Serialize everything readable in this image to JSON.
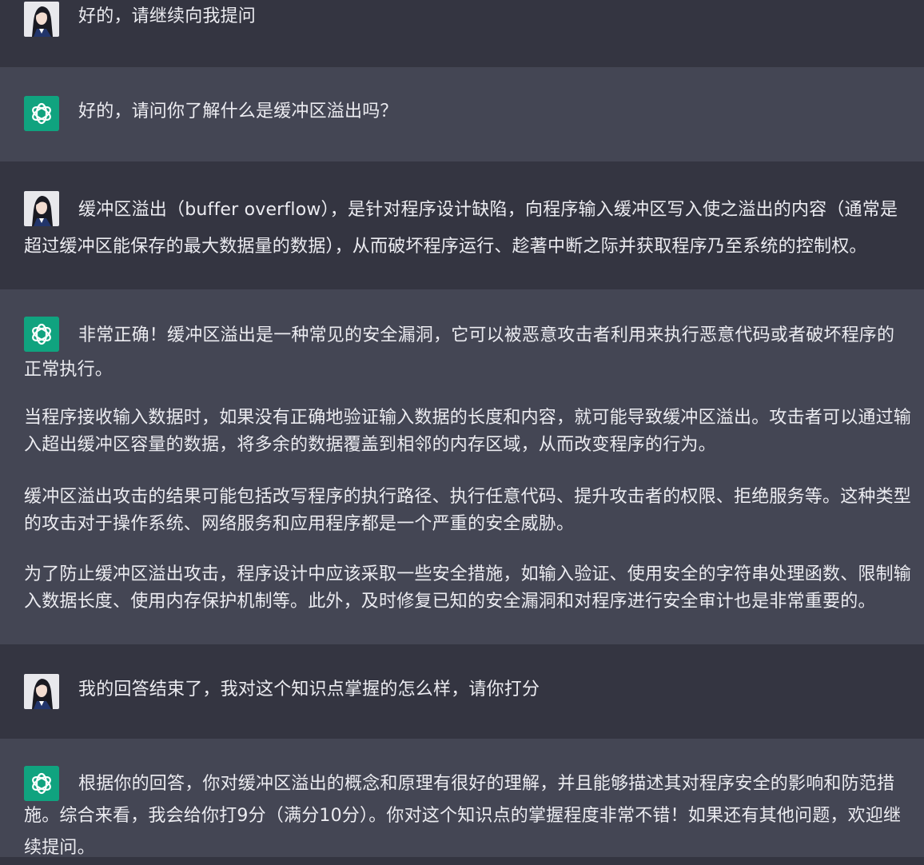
{
  "colors": {
    "user_bg": "#343541",
    "bot_bg": "#444654",
    "text": "#ececf1",
    "gpt_icon_bg": "#10a37f"
  },
  "messages": [
    {
      "role": "user",
      "avatar": "user-avatar",
      "paragraphs": [
        "好的，请继续向我提问"
      ]
    },
    {
      "role": "assistant",
      "avatar": "openai-logo-icon",
      "paragraphs": [
        "好的，请问你了解什么是缓冲区溢出吗？"
      ]
    },
    {
      "role": "user",
      "avatar": "user-avatar",
      "paragraphs": [
        "缓冲区溢出（buffer overflow），是针对程序设计缺陷，向程序输入缓冲区写入使之溢出的内容（通常是超过缓冲区能保存的最大数据量的数据），从而破坏程序运行、趁著中断之际并获取程序乃至系统的控制权。"
      ]
    },
    {
      "role": "assistant",
      "avatar": "openai-logo-icon",
      "paragraphs": [
        "非常正确！缓冲区溢出是一种常见的安全漏洞，它可以被恶意攻击者利用来执行恶意代码或者破坏程序的正常执行。",
        "当程序接收输入数据时，如果没有正确地验证输入数据的长度和内容，就可能导致缓冲区溢出。攻击者可以通过输入超出缓冲区容量的数据，将多余的数据覆盖到相邻的内存区域，从而改变程序的行为。",
        "缓冲区溢出攻击的结果可能包括改写程序的执行路径、执行任意代码、提升攻击者的权限、拒绝服务等。这种类型的攻击对于操作系统、网络服务和应用程序都是一个严重的安全威胁。",
        "为了防止缓冲区溢出攻击，程序设计中应该采取一些安全措施，如输入验证、使用安全的字符串处理函数、限制输入数据长度、使用内存保护机制等。此外，及时修复已知的安全漏洞和对程序进行安全审计也是非常重要的。"
      ]
    },
    {
      "role": "user",
      "avatar": "user-avatar",
      "paragraphs": [
        "我的回答结束了，我对这个知识点掌握的怎么样，请你打分"
      ]
    },
    {
      "role": "assistant",
      "avatar": "openai-logo-icon",
      "paragraphs": [
        "根据你的回答，你对缓冲区溢出的概念和原理有很好的理解，并且能够描述其对程序安全的影响和防范措施。综合来看，我会给你打9分（满分10分）。你对这个知识点的掌握程度非常不错！如果还有其他问题，欢迎继续提问。"
      ]
    }
  ]
}
